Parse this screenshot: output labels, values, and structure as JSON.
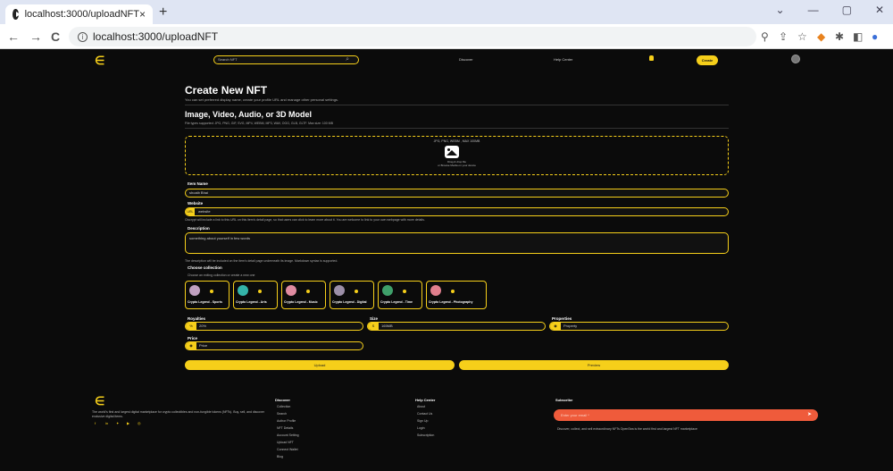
{
  "browser": {
    "tab_title": "localhost:3000/uploadNFT",
    "tab_close": "×",
    "new_tab": "+",
    "url": "localhost:3000/uploadNFT",
    "win_min": "—",
    "win_max": "▢",
    "win_close": "✕",
    "back": "←",
    "forward": "→",
    "reload": "C",
    "info": "i"
  },
  "header": {
    "logo": "∈",
    "search_placeholder": "Search NFT",
    "search_icon": "⌕",
    "nav_discover": "Discover",
    "nav_help": "Help Center",
    "create_label": "Create"
  },
  "page": {
    "title": "Create New NFT",
    "subtitle": "You can set preferred display name, create your profile URL and manage other personal settings.",
    "upload_title": "Image, Video, Audio, or 3D Model",
    "upload_sub": "File types supported: JPG, PNG, GIF, SVG, MP4, WEBM, MP3, WAV, OGG, GLB, GLTF. Max size: 100 MB",
    "dropzone_top": "JPG, PNG, WEBM , MAX 100MB",
    "dropzone_line1": "Drag & drop file",
    "dropzone_line2": "or Browse Media on your device"
  },
  "form": {
    "item_name_label": "Item Name",
    "item_name_value": "shoaib Bhai",
    "website_label": "Website",
    "website_prefix": "URL",
    "website_value": "website",
    "website_help": "Ciscrypt will include a link to this URL on this item's detail page, so that users can click to learn more about it. You are welcome to link to your own webpage with more details.",
    "description_label": "Description",
    "description_value": "something about yourself in few words",
    "description_help": "The description will be included on the item's detail page underneath its image. Markdown syntax is supported.",
    "collection_label": "Choose collection",
    "collection_help": "Choose an exiting collection or create a new one",
    "collections": [
      {
        "name": "Crypto Legend - Sports",
        "color": "#c0a0c0"
      },
      {
        "name": "Crypto Legend - Arts",
        "color": "#34b3a8"
      },
      {
        "name": "Crypto Legend - Music",
        "color": "#e08ba0"
      },
      {
        "name": "Crypto Legend - Digital",
        "color": "#9c8fa8"
      },
      {
        "name": "Crypto Legend - Time",
        "color": "#3fa06a"
      },
      {
        "name": "Crypto Legend - Photography",
        "color": "#e07f8d"
      }
    ],
    "royalties_label": "Royalties",
    "royalties_prefix": "%",
    "royalties_value": "20%",
    "size_label": "Size",
    "size_prefix": "S",
    "size_value": "165MB",
    "properties_label": "Properties",
    "properties_prefix": "◉",
    "properties_value": "Property",
    "price_label": "Price",
    "price_prefix": "◉",
    "price_value": "Price",
    "upload_button": "Upload",
    "preview_button": "Preview"
  },
  "footer": {
    "logo": "∈",
    "about_text": "The world's first and largest digital marketplace for crypto collectibles and non-fungible tokens (NFTs). Buy, sell, and discover exclusive digital items.",
    "social": [
      "f",
      "in",
      "✦",
      "▶",
      "◎"
    ],
    "discover_title": "Discover",
    "discover_links": [
      "Collection",
      "Search",
      "Author Profile",
      "NFT Details",
      "Account Setting",
      "Upload NFT",
      "Connect Wallet",
      "Blog"
    ],
    "help_title": "Help Center",
    "help_links": [
      "About",
      "Contact Us",
      "Sign Up",
      "Login",
      "Subscription"
    ],
    "subscribe_title": "Subscribe",
    "subscribe_placeholder": "Enter your email *",
    "subscribe_arrow": "➤",
    "subscribe_text": "Discover, collect, and sell extraordinary NFTs OpenSea is the world first and largest NFT marketplace"
  },
  "colors": {
    "accent": "#f6cf1a",
    "background": "#0b0b0b",
    "subscribe": "#ef5b3b"
  }
}
